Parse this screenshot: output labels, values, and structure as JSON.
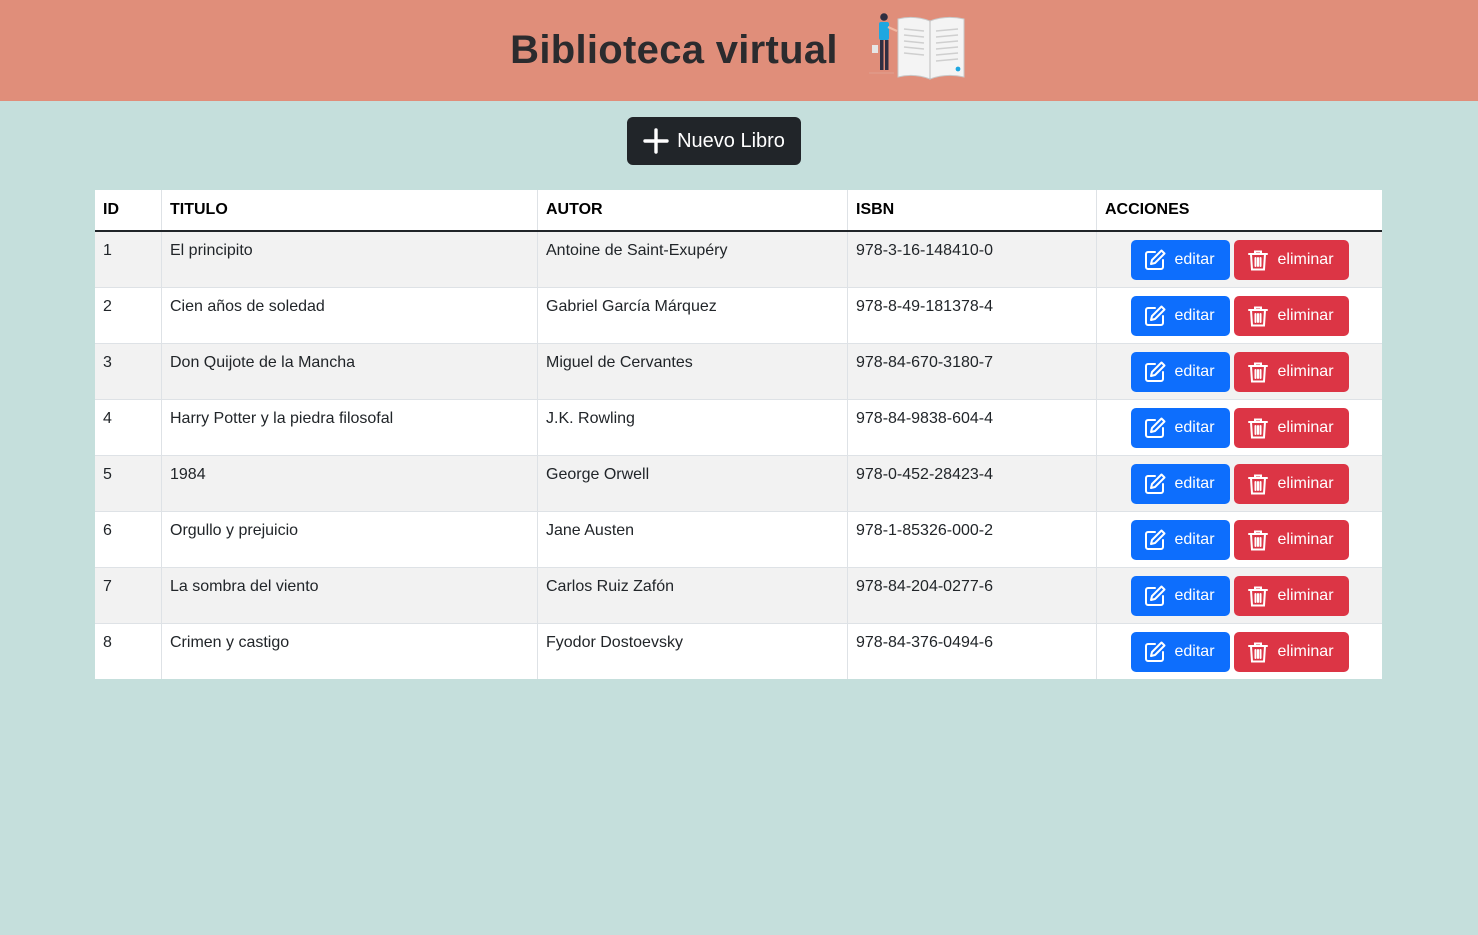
{
  "header": {
    "title": "Biblioteca virtual"
  },
  "toolbar": {
    "new_book_label": "Nuevo Libro"
  },
  "table": {
    "columns": [
      "ID",
      "TITULO",
      "AUTOR",
      "ISBN",
      "ACCIONES"
    ],
    "edit_label": "editar",
    "delete_label": "eliminar",
    "rows": [
      {
        "id": "1",
        "title": "El principito",
        "author": "Antoine de Saint-Exupéry",
        "isbn": "978-3-16-148410-0"
      },
      {
        "id": "2",
        "title": "Cien años de soledad",
        "author": "Gabriel García Márquez",
        "isbn": "978-8-49-181378-4"
      },
      {
        "id": "3",
        "title": "Don Quijote de la Mancha",
        "author": "Miguel de Cervantes",
        "isbn": "978-84-670-3180-7"
      },
      {
        "id": "4",
        "title": "Harry Potter y la piedra filosofal",
        "author": "J.K. Rowling",
        "isbn": "978-84-9838-604-4"
      },
      {
        "id": "5",
        "title": "1984",
        "author": "George Orwell",
        "isbn": "978-0-452-28423-4"
      },
      {
        "id": "6",
        "title": "Orgullo y prejuicio",
        "author": "Jane Austen",
        "isbn": "978-1-85326-000-2"
      },
      {
        "id": "7",
        "title": "La sombra del viento",
        "author": "Carlos Ruiz Zafón",
        "isbn": "978-84-204-0277-6"
      },
      {
        "id": "8",
        "title": "Crimen y castigo",
        "author": "Fyodor Dostoevsky",
        "isbn": "978-84-376-0494-6"
      }
    ]
  },
  "icons": {
    "header_illustration": "reading-book-illustration",
    "new_book": "plus-icon",
    "edit": "edit-icon",
    "delete": "trash-icon"
  },
  "colors": {
    "header_bg": "#e08e7a",
    "page_bg": "#c5dfdc",
    "primary": "#0d6efd",
    "danger": "#dc3545",
    "dark": "#212529"
  }
}
